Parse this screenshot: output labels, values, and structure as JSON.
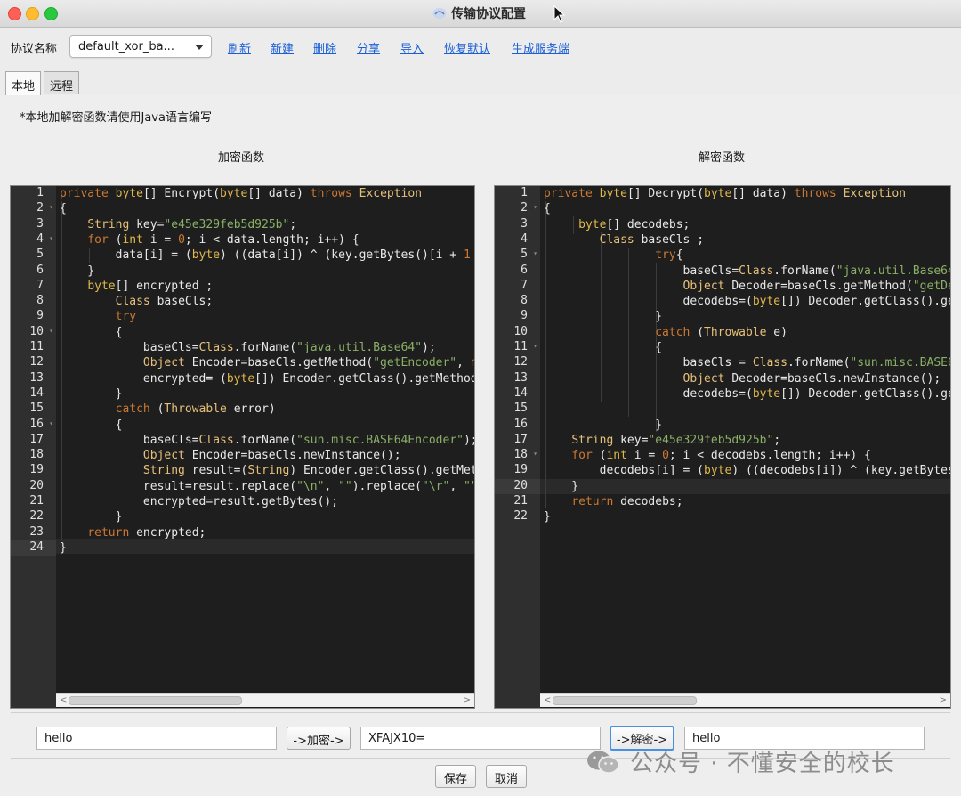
{
  "window": {
    "title": "传输协议配置"
  },
  "toolbar": {
    "protocol_label": "协议名称",
    "protocol_value": "default_xor_ba...",
    "links": [
      "刷新",
      "新建",
      "删除",
      "分享",
      "导入",
      "恢复默认",
      "生成服务端"
    ]
  },
  "tabs": [
    "本地",
    "远程"
  ],
  "note": "*本地加解密函数请使用Java语言编写",
  "encrypt": {
    "title": "加密函数",
    "line_numbers": [
      "1",
      "2",
      "3",
      "4",
      "5",
      "6",
      "7",
      "8",
      "9",
      "10",
      "11",
      "12",
      "13",
      "14",
      "15",
      "16",
      "17",
      "18",
      "19",
      "20",
      "21",
      "22",
      "23",
      "24"
    ],
    "fold_lines": [
      2,
      4,
      10,
      16
    ],
    "current_line": 24
  },
  "decrypt": {
    "title": "解密函数",
    "line_numbers": [
      "1",
      "2",
      "3",
      "4",
      "5",
      "6",
      "7",
      "8",
      "9",
      "10",
      "11",
      "12",
      "13",
      "14",
      "15",
      "16",
      "17",
      "18",
      "19",
      "20",
      "21",
      "22"
    ],
    "fold_lines": [
      2,
      5,
      11,
      18
    ],
    "current_line": 20
  },
  "bottom": {
    "input_plain": "hello",
    "encrypt_button": "->加密->",
    "cipher_value": "XFAJX10=",
    "decrypt_button": "->解密->",
    "output_plain": "hello",
    "save_button": "保存",
    "cancel_button": "取消"
  },
  "watermark": "公众号 · 不懂安全的校长"
}
